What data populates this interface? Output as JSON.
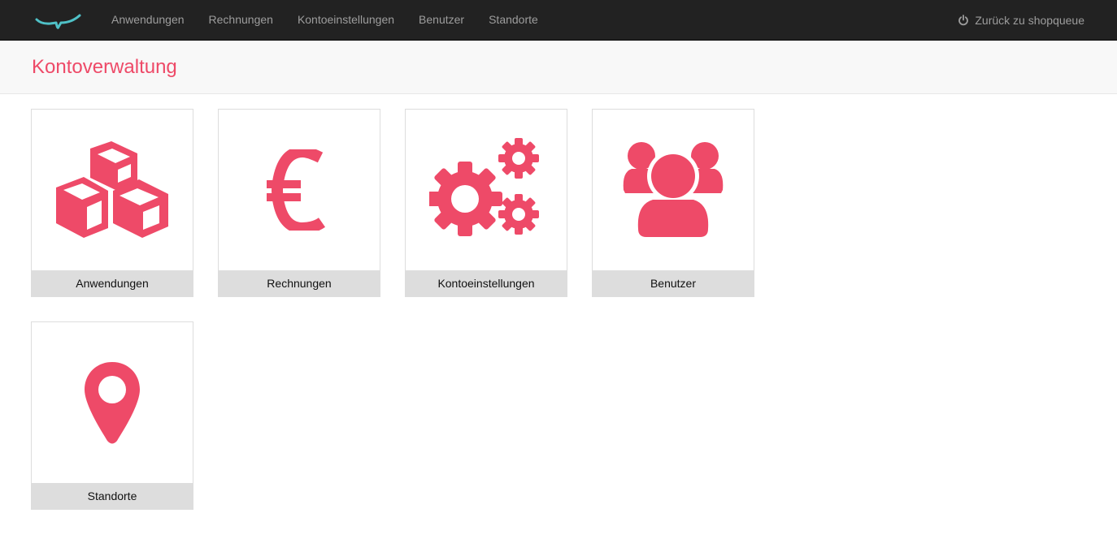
{
  "colors": {
    "accent": "#ee4a68",
    "navbar_bg": "#222222",
    "nav_text": "#9d9d9d",
    "logo": "#4fc1c7",
    "label_bg": "#dddddd"
  },
  "navbar": {
    "logo_icon": "shopqueue-logo-icon",
    "links": [
      {
        "label": "Anwendungen"
      },
      {
        "label": "Rechnungen"
      },
      {
        "label": "Kontoeinstellungen"
      },
      {
        "label": "Benutzer"
      },
      {
        "label": "Standorte"
      }
    ],
    "back": {
      "icon": "power-icon",
      "label": "Zurück zu shopqueue"
    }
  },
  "header": {
    "title": "Kontoverwaltung"
  },
  "tiles": [
    {
      "label": "Anwendungen",
      "icon": "cubes-icon"
    },
    {
      "label": "Rechnungen",
      "icon": "euro-icon"
    },
    {
      "label": "Kontoeinstellungen",
      "icon": "gears-icon"
    },
    {
      "label": "Benutzer",
      "icon": "users-icon"
    },
    {
      "label": "Standorte",
      "icon": "map-marker-icon"
    }
  ]
}
